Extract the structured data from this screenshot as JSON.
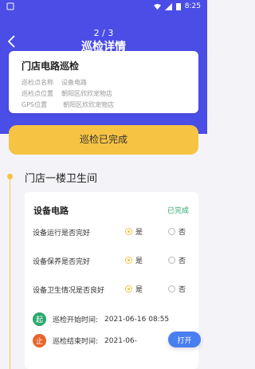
{
  "status_bar": {
    "time": "8:25"
  },
  "header": {
    "pager": "2 / 3",
    "title": "巡检详情"
  },
  "info_card": {
    "title": "门店电路巡检",
    "rows": [
      {
        "label": "巡检点名称",
        "value": "设备电路"
      },
      {
        "label": "巡检点位置",
        "value": "朝阳区欣欣宠物店"
      },
      {
        "label": "GPS位置",
        "value": "朝阳区欣欣宠物店"
      }
    ]
  },
  "status_button": {
    "label": "巡检已完成"
  },
  "section": {
    "title": "门店一楼卫生间"
  },
  "check_card": {
    "device": "设备电路",
    "status": "已完成",
    "options": {
      "yes": "是",
      "no": "否"
    },
    "questions": [
      {
        "text": "设备运行是否完好",
        "answer": "yes"
      },
      {
        "text": "设备保养是否完好",
        "answer": "yes"
      },
      {
        "text": "设备卫生情况是否良好",
        "answer": "yes"
      }
    ],
    "start": {
      "badge": "起",
      "label": "巡检开始时间:",
      "value": "2021-06-16 08:55"
    },
    "end": {
      "badge": "止",
      "label": "巡检结束时间:",
      "value": "2021-06-"
    }
  },
  "open_button": {
    "label": "打开"
  },
  "colors": {
    "primary": "#4a4de6",
    "accent": "#f6c343",
    "success": "#2aa86c",
    "danger": "#e7652b"
  }
}
